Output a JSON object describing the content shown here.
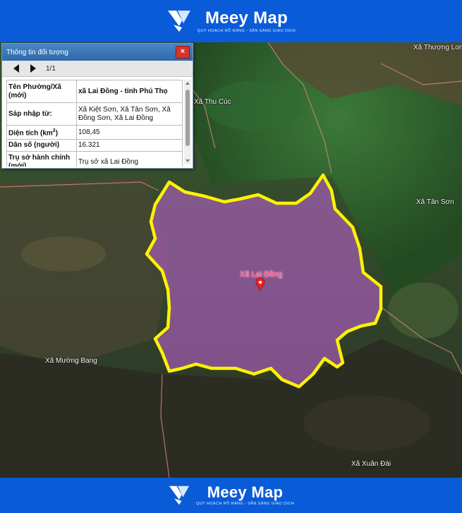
{
  "brand": {
    "name": "Meey Map",
    "tagline": "QUY HOẠCH RÕ RÀNG - SẴN SÀNG GIAO DỊCH",
    "color": "#0a5bd8"
  },
  "info_panel": {
    "title": "Thông tin đối tượng",
    "close_label": "×",
    "page_indicator": "1/1",
    "rows": [
      {
        "key": "Tên Phường/Xã (mới)",
        "value": "xã Lai Đồng - tỉnh Phú Thọ"
      },
      {
        "key": "Sáp nhập từ:",
        "value": "Xã Kiệt Sơn, Xã Tân Sơn, Xã Đồng Sơn, Xã Lai Đồng"
      },
      {
        "key_main": "Diện tích (km",
        "key_sup": "2",
        "key_end": ")",
        "value": "108,45"
      },
      {
        "key": "Dân số (người)",
        "value": "16.321"
      },
      {
        "key": "Trụ sở hành chính (mới)",
        "value": "Trụ sở xã Lai Đồng"
      }
    ]
  },
  "map": {
    "selected_commune": "Xã Lai Đồng",
    "highlight_fill": "#b45fc8",
    "boundary_color": "#fff200",
    "labels": {
      "thuong_long": "Xã Thượng Long",
      "thu_cuc": "Xã Thu Cúc",
      "tan_son": "Xã Tân Sơn",
      "muong_bang": "Xã Mường Bang",
      "xuan_dai": "Xã Xuân Đài"
    }
  }
}
